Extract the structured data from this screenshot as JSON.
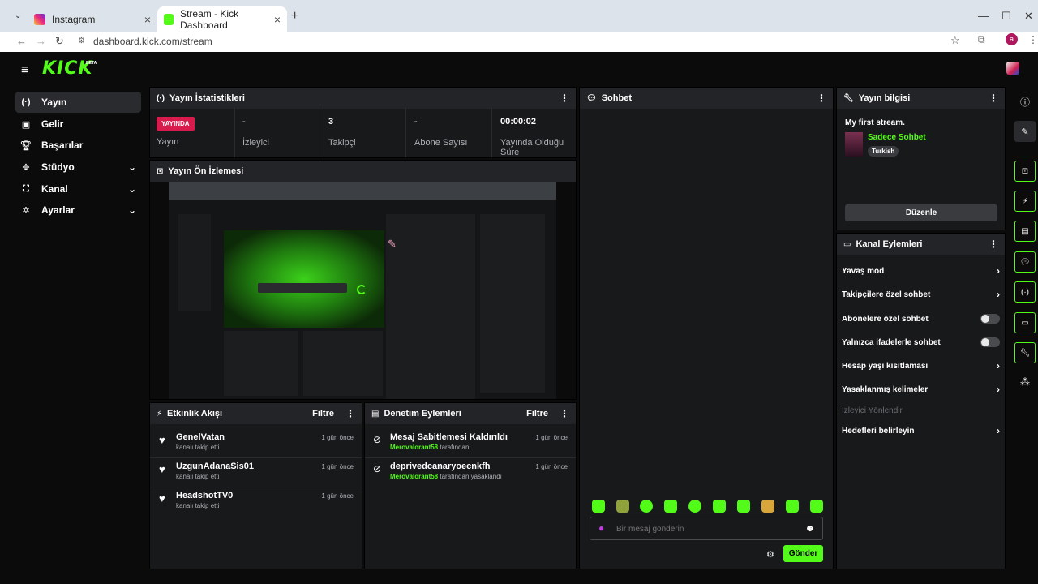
{
  "browser": {
    "tabs": [
      {
        "title": "Instagram",
        "active": false
      },
      {
        "title": "Stream - Kick Dashboard",
        "active": true
      }
    ],
    "url": "dashboard.kick.com/stream",
    "profile_initial": "a"
  },
  "brand": {
    "logo": "KICK",
    "beta": "BETA"
  },
  "sidebar": {
    "items": [
      {
        "label": "Yayın",
        "icon": "broadcast-icon",
        "active": true
      },
      {
        "label": "Gelir",
        "icon": "wallet-icon"
      },
      {
        "label": "Başarılar",
        "icon": "trophy-icon"
      },
      {
        "label": "Stüdyo",
        "icon": "studio-icon",
        "expandable": true
      },
      {
        "label": "Kanal",
        "icon": "channel-icon",
        "expandable": true
      },
      {
        "label": "Ayarlar",
        "icon": "gear-icon",
        "expandable": true
      }
    ]
  },
  "stats": {
    "title": "Yayın İstatistikleri",
    "live_badge": "YAYINDA",
    "items": [
      {
        "value": "",
        "label": "Yayın"
      },
      {
        "value": "-",
        "label": "İzleyici"
      },
      {
        "value": "3",
        "label": "Takipçi"
      },
      {
        "value": "-",
        "label": "Abone Sayısı"
      },
      {
        "value": "00:00:02",
        "label": "Yayında Olduğu Süre"
      }
    ]
  },
  "preview": {
    "title": "Yayın Ön İzlemesi"
  },
  "activity": {
    "title": "Etkinlik Akışı",
    "filter": "Filtre",
    "rows": [
      {
        "name": "GenelVatan",
        "sub": "kanalı takip etti",
        "time": "1 gün önce"
      },
      {
        "name": "UzgunAdanaSis01",
        "sub": "kanalı takip etti",
        "time": "1 gün önce"
      },
      {
        "name": "HeadshotTV0",
        "sub": "kanalı takip etti",
        "time": "1 gün önce"
      }
    ]
  },
  "moderation": {
    "title": "Denetim Eylemleri",
    "filter": "Filtre",
    "rows": [
      {
        "name": "Mesaj Sabitlemesi Kaldırıldı",
        "user": "Merovalorant58",
        "sub": "tarafından",
        "time": "1 gün önce"
      },
      {
        "name": "deprivedcanaryoecnkfh",
        "user": "Merovalorant58",
        "sub": "tarafından yasaklandı",
        "time": "1 gün önce"
      }
    ]
  },
  "chat": {
    "title": "Sohbet",
    "placeholder": "Bir mesaj gönderin",
    "send": "Gönder"
  },
  "stream_info": {
    "title": "Yayın bilgisi",
    "stream_title": "My first stream.",
    "category": "Sadece Sohbet",
    "tag": "Turkish",
    "edit": "Düzenle"
  },
  "channel_actions": {
    "title": "Kanal Eylemleri",
    "rows": [
      {
        "label": "Yavaş mod",
        "control": "chevron"
      },
      {
        "label": "Takipçilere özel sohbet",
        "control": "chevron"
      },
      {
        "label": "Abonelere özel sohbet",
        "control": "toggle"
      },
      {
        "label": "Yalnızca ifadelerle sohbet",
        "control": "toggle"
      },
      {
        "label": "Hesap yaşı kısıtlaması",
        "control": "chevron"
      },
      {
        "label": "Yasaklanmış kelimeler",
        "control": "chevron"
      },
      {
        "label": "İzleyici Yönlendir",
        "control": "none",
        "disabled": true
      },
      {
        "label": "Hedefleri belirleyin",
        "control": "chevron"
      }
    ]
  },
  "colors": {
    "accent": "#53fc18",
    "live": "#d91a4c"
  }
}
